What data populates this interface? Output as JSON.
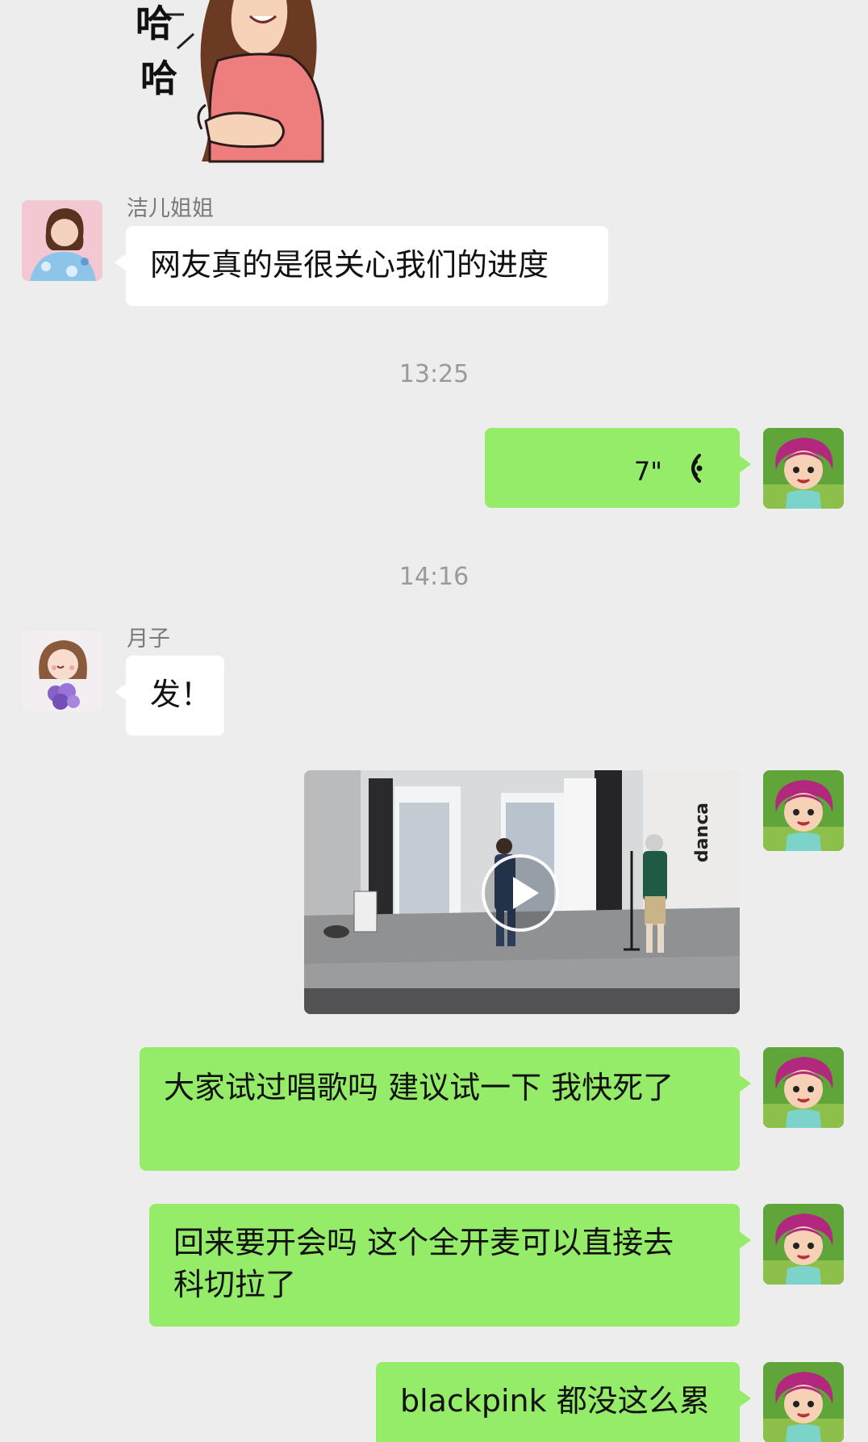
{
  "sticker": {
    "text_line1": "哈",
    "text_line2": "哈"
  },
  "messages": [
    {
      "type": "text",
      "side": "left",
      "sender": "洁儿姐姐",
      "text": "网友真的是很关心我们的进度"
    },
    {
      "type": "timestamp",
      "text": "13:25"
    },
    {
      "type": "voice",
      "side": "right",
      "duration": "7\""
    },
    {
      "type": "timestamp",
      "text": "14:16"
    },
    {
      "type": "text",
      "side": "left",
      "sender": "月子",
      "text": "发！"
    },
    {
      "type": "video",
      "side": "right"
    },
    {
      "type": "text",
      "side": "right",
      "text": "大家试过唱歌吗 建议试一下 我快死了"
    },
    {
      "type": "text",
      "side": "right",
      "text_lines": [
        "回来要开会吗 这个全开麦可以直接去",
        "科切拉了"
      ]
    },
    {
      "type": "text",
      "side": "right",
      "text": "blackpink 都没这么累"
    }
  ],
  "colors": {
    "background": "#ededed",
    "bubble_self": "#95ec69",
    "bubble_other": "#ffffff",
    "timestamp": "#9a9a9a",
    "sender_name": "#7a7a7a"
  },
  "icons": {
    "voice": "voice-wave-icon",
    "video": "play-icon"
  }
}
